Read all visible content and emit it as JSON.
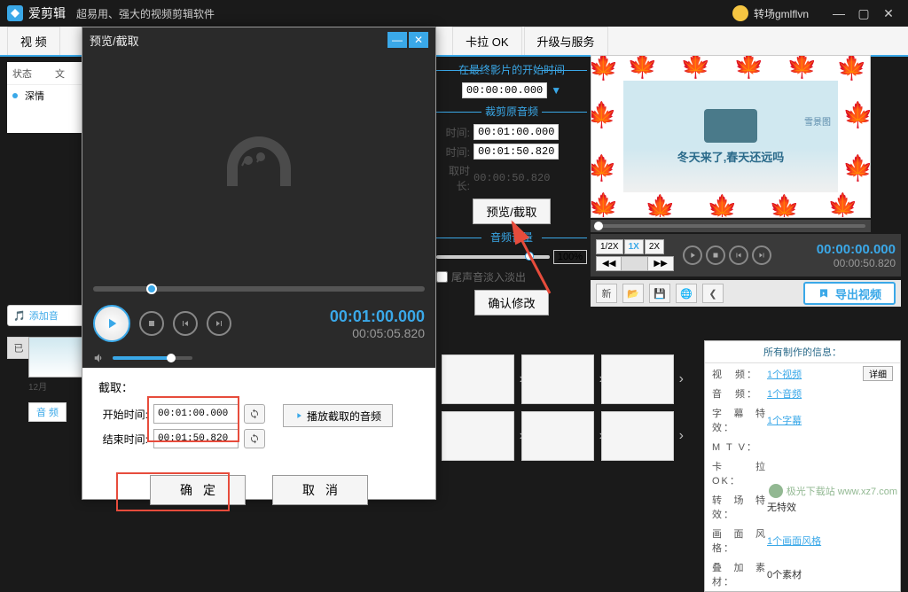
{
  "app": {
    "name": "爱剪辑",
    "slogan": "超易用、强大的视频剪辑软件",
    "user": "转场gmlflvn"
  },
  "tabs": {
    "t0": "视 频",
    "t3": "卡拉 OK",
    "t4": "升级与服务"
  },
  "left": {
    "col_state": "状态",
    "col_file": "文",
    "item1": "深情"
  },
  "modal": {
    "title": "预览/截取",
    "time_current": "00:01:00.000",
    "time_total": "00:05:05.820",
    "clip_header": "截取：",
    "start_label": "开始时间:",
    "end_label": "结束时间:",
    "start_value": "00:01:00.000",
    "end_value": "00:01:50.820",
    "play_clip": "播放截取的音频",
    "ok": "确定",
    "cancel": "取消"
  },
  "mid": {
    "group1_title": "在最终影片的开始时间",
    "g1_time": "00:00:00.000",
    "group2_title": "裁剪原音频",
    "g2_start_label": "时间:",
    "g2_start": "00:01:00.000",
    "g2_end_label": "时间:",
    "g2_end": "00:01:50.820",
    "g2_dur_label": "取时长:",
    "g2_dur": "00:00:50.820",
    "preview_btn": "预览/截取",
    "group3_title": "音频音量",
    "volume_pct": "100%",
    "fade": "尾声音淡入淡出",
    "confirm": "确认修改"
  },
  "vid": {
    "caption": "冬天来了,春天还远吗",
    "caption2": "雪景图",
    "speeds": {
      "s1": "1/2X",
      "s2": "1X",
      "s3": "2X"
    },
    "nav_prev": "◀◀",
    "nav_next": "▶▶",
    "t1": "00:00:00.000",
    "t2": "00:00:50.820",
    "toolbar_new": "新",
    "export": "导出视频"
  },
  "bottom": {
    "add_audio": "添加音",
    "added": "已添加片段",
    "thumb_label": "12月",
    "audio_tab": "音 频"
  },
  "info": {
    "title": "所有制作的信息：",
    "video_k": "视　频：",
    "video_v": "1个视频",
    "detail": "详细",
    "audio_k": "音　频：",
    "audio_v": "1个音频",
    "sub_k": "字幕特效：",
    "sub_v": "1个字幕",
    "mtv_k": "M T V：",
    "kara_k": "卡拉 OK：",
    "trans_k": "转场特效：",
    "trans_v": "无特效",
    "style_k": "画面风格：",
    "style_v": "1个画面风格",
    "overlay_k": "叠加素材：",
    "overlay_v": "0个素材"
  },
  "watermark": "极光下载站 www.xz7.com"
}
